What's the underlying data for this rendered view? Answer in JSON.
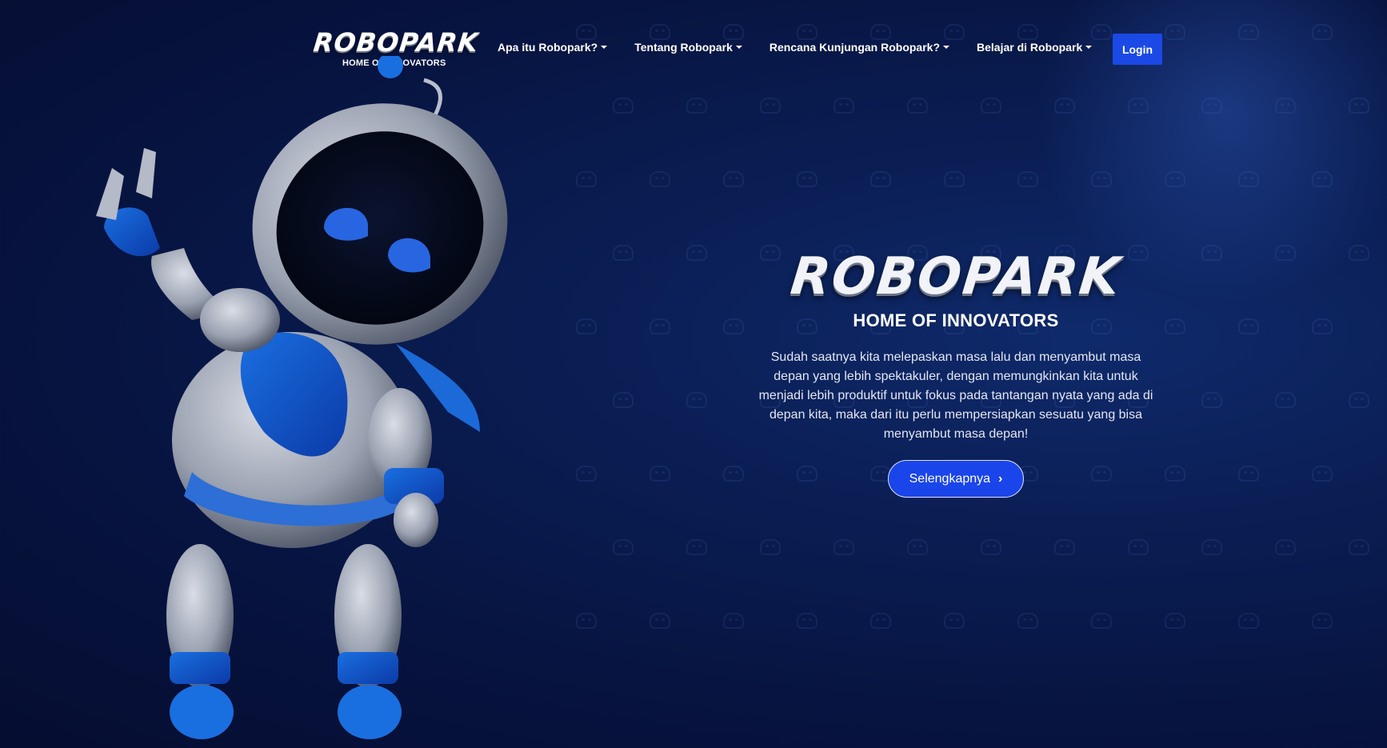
{
  "brand": {
    "name": "ROBOPARK",
    "tagline": "HOME OF INNOVATORS"
  },
  "nav": {
    "items": [
      {
        "label": "Apa itu Robopark?"
      },
      {
        "label": "Tentang Robopark"
      },
      {
        "label": "Rencana Kunjungan Robopark?"
      },
      {
        "label": "Belajar di Robopark"
      }
    ],
    "login_label": "Login"
  },
  "hero": {
    "title": "ROBOPARK",
    "subtitle": "HOME OF INNOVATORS",
    "description": "Sudah saatnya kita melepaskan masa lalu dan menyambut masa depan yang lebih spektakuler, dengan memungkinkan kita untuk menjadi lebih produktif untuk fokus pada tantangan nyata yang ada di depan kita, maka dari itu perlu mempersiapkan sesuatu yang bisa menyambut masa depan!",
    "cta_label": "Selengkapnya",
    "cta_icon": "chevron-right-icon"
  },
  "colors": {
    "accent": "#1a45ea",
    "background": "#071441"
  }
}
